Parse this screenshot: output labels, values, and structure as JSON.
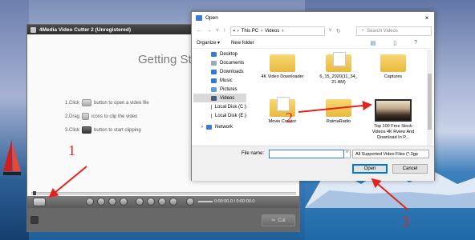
{
  "vc": {
    "title": "4Media Video Cutter 2 (Unregistered)",
    "heading": "Getting St",
    "steps": [
      {
        "num": "1.Click",
        "text": "button to open a video file"
      },
      {
        "num": "2.Drag",
        "text": "icons to clip the video"
      },
      {
        "num": "3.Click",
        "text": "button to start clipping"
      }
    ],
    "time": "0:00:00.0 / 0:00:00.0",
    "cut_label": "Cut"
  },
  "dialog": {
    "title": "Open",
    "breadcrumb": [
      "This PC",
      "Videos"
    ],
    "search_placeholder": "Search Videos",
    "organize": "Organize ▾",
    "new_folder": "New folder",
    "nav": [
      "Desktop",
      "Documents",
      "Downloads",
      "Music",
      "Pictures",
      "Videos",
      "Local Disk (C:)",
      "Local Disk (E:)",
      "Network"
    ],
    "files": [
      {
        "name": "4K Video Downloader"
      },
      {
        "name": "6_15_2020(11_34_ 21 AM)"
      },
      {
        "name": "Captures"
      },
      {
        "name": "Movie Creator"
      },
      {
        "name": "RaimaRadio"
      },
      {
        "name": "Top 100 Free Stock Videos 4K Rview And Download In P..."
      }
    ],
    "file_name_label": "File name:",
    "file_name_value": "",
    "filter": "All Supported Video Files (*.3gp",
    "open_label": "Open",
    "cancel_label": "Cancel"
  },
  "annotations": {
    "a1": "1",
    "a2": "2",
    "a3": "3"
  },
  "colors": {
    "annotation": "#e2231a",
    "accent": "#0078d7"
  }
}
